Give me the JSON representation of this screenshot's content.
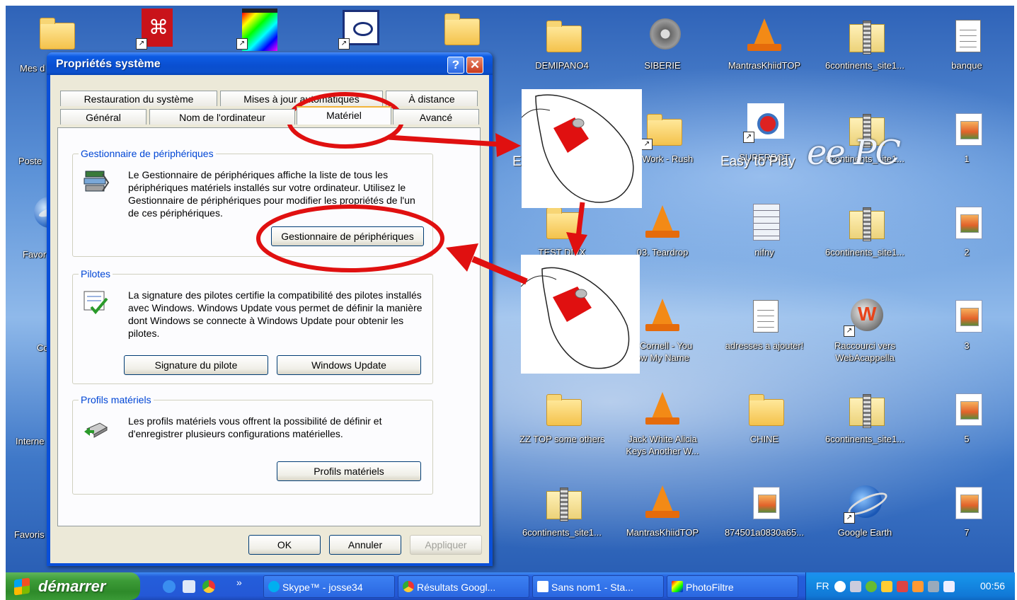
{
  "desktop": {
    "icons": [
      {
        "id": "demipano4",
        "label": "DEMIPANO4"
      },
      {
        "id": "siberie",
        "label": "SIBERIE"
      },
      {
        "id": "mantrastop",
        "label": "MantrasKhiidTOP"
      },
      {
        "id": "sixcont_a",
        "label": "6continents_site1..."
      },
      {
        "id": "banque",
        "label": "banque"
      },
      {
        "id": "superbot",
        "label": "SUPERBOT"
      },
      {
        "id": "sixcont_b",
        "label": "6continents_site1..."
      },
      {
        "id": "num1",
        "label": "1"
      },
      {
        "id": "teardrop",
        "label": "03. Teardrop"
      },
      {
        "id": "nifny",
        "label": "nifny"
      },
      {
        "id": "sixcont_c",
        "label": "6continents_site1..."
      },
      {
        "id": "num2",
        "label": "2"
      },
      {
        "id": "cornell",
        "label": "s Cornell - You\now My Name"
      },
      {
        "id": "adresses",
        "label": "adresses a ajouter!"
      },
      {
        "id": "webacappella",
        "label": "Raccourci vers\nWebAcappella"
      },
      {
        "id": "num3",
        "label": "3"
      },
      {
        "id": "zztop",
        "label": "ZZ TOP some others"
      },
      {
        "id": "jackwhite",
        "label": "Jack White  Alicia\nKeys Another W..."
      },
      {
        "id": "chine",
        "label": "CHINE"
      },
      {
        "id": "sixcont_d",
        "label": "6continents_site1..."
      },
      {
        "id": "num5",
        "label": "5"
      },
      {
        "id": "sixcont_e",
        "label": "6continents_site1..."
      },
      {
        "id": "mantras2",
        "label": "MantrasKhiidTOP"
      },
      {
        "id": "hexfile",
        "label": "874501a0830a65..."
      },
      {
        "id": "gearth",
        "label": "Google Earth"
      },
      {
        "id": "num7",
        "label": "7"
      },
      {
        "id": "testdivx",
        "label": "TEST DIVX"
      },
      {
        "id": "workrush",
        "label": "to Work - Rush"
      }
    ],
    "left_edge_labels": [
      "Mes d",
      "Poste",
      "Favor",
      "Co",
      "Interne",
      "Favoris"
    ],
    "easy_text_a": "Easy to Play",
    "easy_text_b": "Ea",
    "eepc_logo": "ee PC"
  },
  "dialog": {
    "title": "Propriétés système",
    "tabs_back": [
      "Restauration du système",
      "Mises à jour automatiques",
      "À distance"
    ],
    "tabs_front": [
      "Général",
      "Nom de l'ordinateur",
      "Matériel",
      "Avancé"
    ],
    "active_tab": "Matériel",
    "groups": {
      "device_manager": {
        "title": "Gestionnaire de périphériques",
        "text": "Le Gestionnaire de périphériques affiche la liste de tous les périphériques matériels installés sur votre ordinateur. Utilisez le Gestionnaire de périphériques pour modifier les propriétés de l'un de ces périphériques.",
        "button": "Gestionnaire de périphériques"
      },
      "drivers": {
        "title": "Pilotes",
        "text": "La signature des pilotes certifie la compatibilité des pilotes installés avec Windows. Windows Update vous permet de définir la manière dont Windows se connecte à Windows Update pour obtenir les pilotes.",
        "button_signature": "Signature du pilote",
        "button_update": "Windows Update"
      },
      "profiles": {
        "title": "Profils matériels",
        "text": "Les profils matériels vous offrent la possibilité de définir et d'enregistrer plusieurs configurations matérielles.",
        "button": "Profils matériels"
      }
    },
    "buttons": {
      "ok": "OK",
      "cancel": "Annuler",
      "apply": "Appliquer"
    }
  },
  "annotation": {
    "color": "#e01010"
  },
  "taskbar": {
    "start_label": "démarrer",
    "chevron": "»",
    "tasks": [
      "Skype™ - josse34",
      "Résultats Googl...",
      "Sans nom1 - Sta...",
      "PhotoFiltre"
    ],
    "language": "FR",
    "clock": "00:56"
  }
}
